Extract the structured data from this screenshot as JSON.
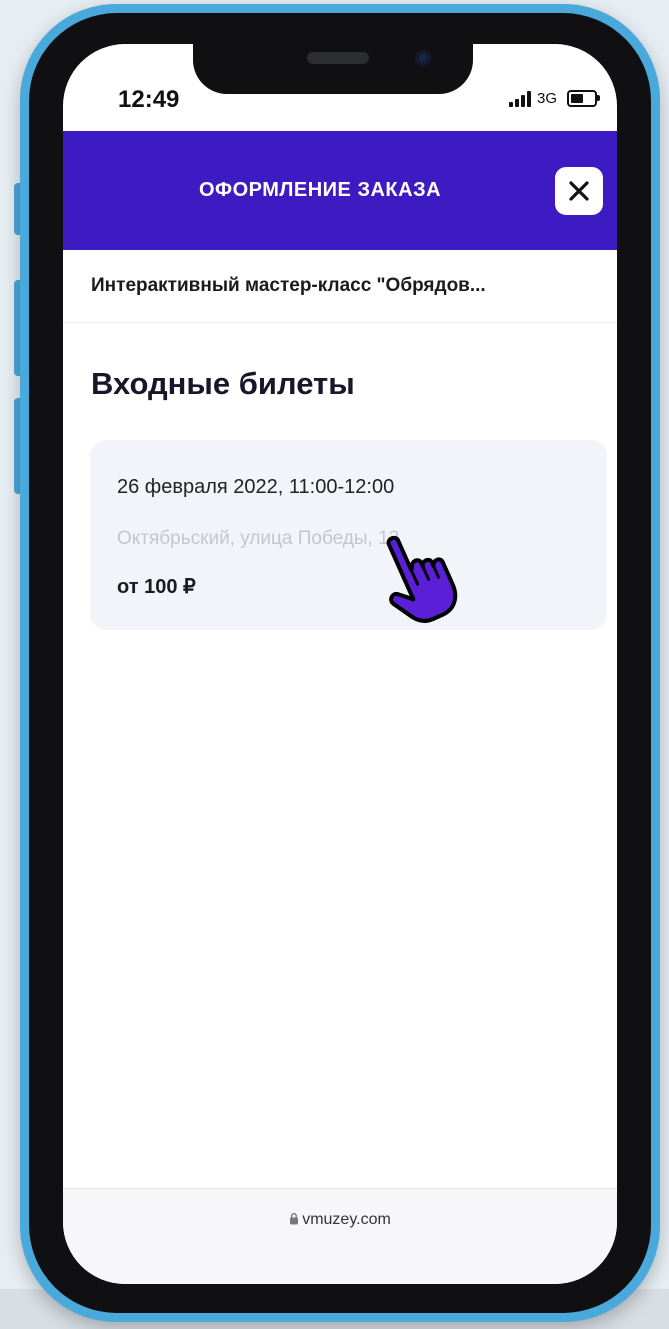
{
  "status_bar": {
    "time": "12:49",
    "network": "3G",
    "signal_bars": 4,
    "battery_level": 0.6
  },
  "header": {
    "title": "ОФОРМЛЕНИЕ ЗАКАЗА",
    "close_icon": "close-icon",
    "background_color": "#3d1bc3"
  },
  "event": {
    "title": "Интерактивный мастер-класс \"Обрядов..."
  },
  "tickets": {
    "section_title": "Входные билеты",
    "items": [
      {
        "datetime": "26 февраля 2022, 11:00-12:00",
        "address": "Октябрьский, улица Победы, 12",
        "price": "от 100 ₽"
      }
    ]
  },
  "browser": {
    "url": "vmuzey.com",
    "lock_icon": "lock-icon"
  },
  "colors": {
    "accent": "#3d1bc3",
    "phone_frame": "#49a9da",
    "card_background": "#f3f4f9",
    "cursor": "#5a1fd6"
  }
}
